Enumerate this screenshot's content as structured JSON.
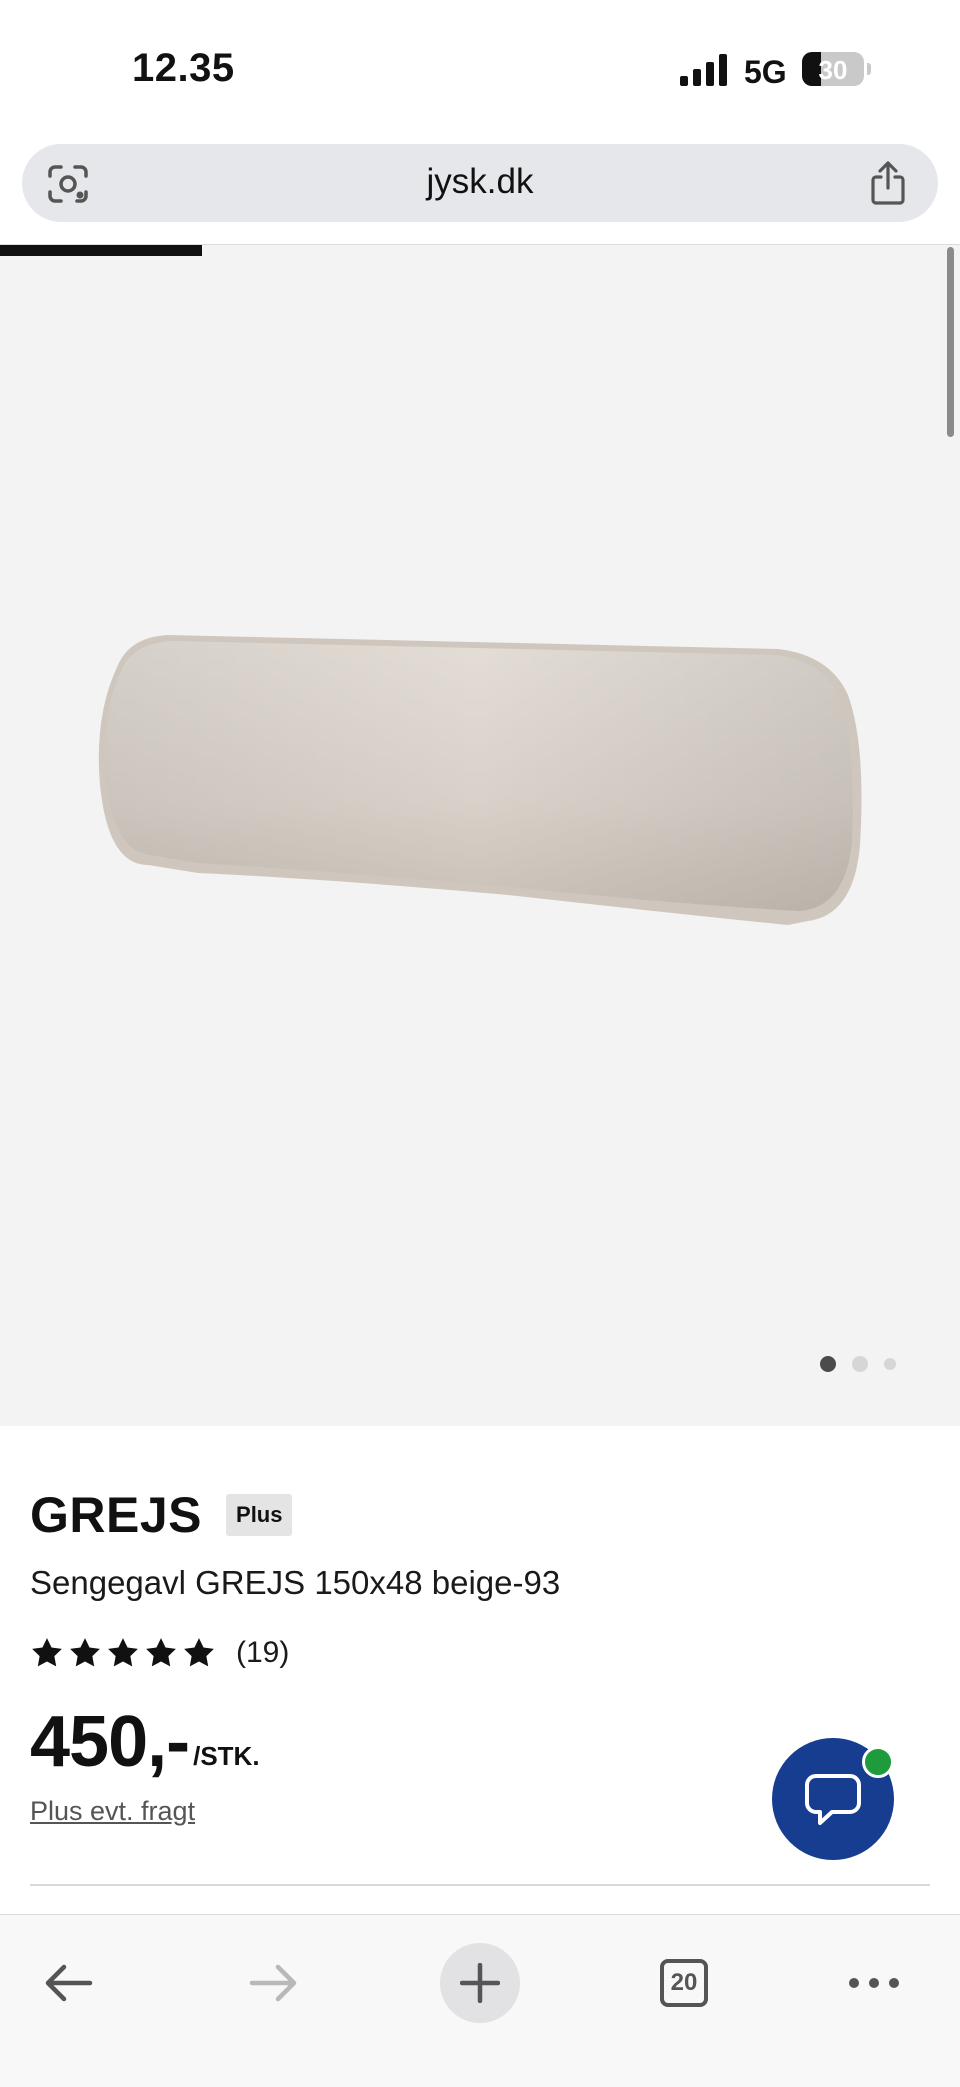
{
  "status_bar": {
    "time": "12.35",
    "network": "5G",
    "battery": "30",
    "battery_level": 0.3,
    "icons": [
      "cellular-signal-icon",
      "battery-icon"
    ]
  },
  "address_bar": {
    "url": "jysk.dk",
    "icons": [
      "google-lens-icon",
      "share-icon"
    ]
  },
  "gallery": {
    "image": "headboard-product-image",
    "total_images": 3,
    "active_index": 0,
    "progress": 0.21
  },
  "product": {
    "brand": "GREJS",
    "badge": "Plus",
    "name": "Sengegavl GREJS 150x48 beige-93",
    "rating_stars": 5,
    "review_count": "(19)",
    "price": "450,-",
    "price_unit": "/STK.",
    "shipping_note": "Plus evt. fragt"
  },
  "chat": {
    "icon": "chat-bubble-icon",
    "status_color": "#1e9b3c",
    "color": "#163d8f"
  },
  "toolbar": {
    "tab_count": "20",
    "icons": [
      "back-arrow-icon",
      "forward-arrow-icon",
      "plus-icon",
      "tabs-icon",
      "more-icon"
    ]
  }
}
